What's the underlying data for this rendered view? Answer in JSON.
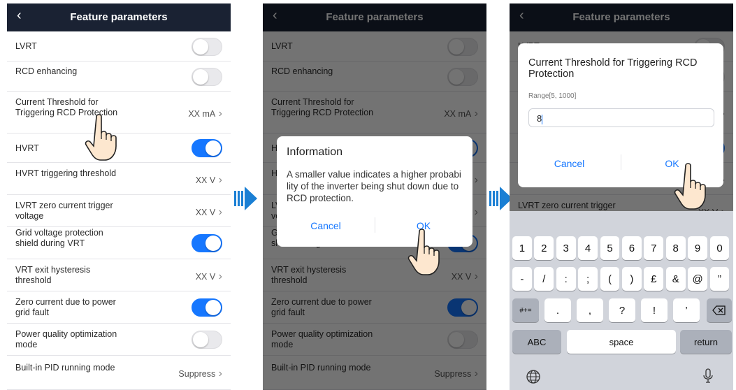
{
  "header_title": "Feature parameters",
  "back_icon": "‹",
  "rows": [
    {
      "label": "LVRT",
      "toggle": "off"
    },
    {
      "label": "RCD enhancing",
      "toggle": "off"
    },
    {
      "label": "Current Threshold for Triggering RCD Protection",
      "value": "XX mA"
    },
    {
      "label": "HVRT",
      "toggle": "on"
    },
    {
      "label": "HVRT triggering threshold",
      "value": "XX V"
    },
    {
      "label": "LVRT zero current trigger voltage",
      "value": "XX V"
    },
    {
      "label": "Grid voltage protection shield during VRT",
      "toggle": "on"
    },
    {
      "label": "VRT exit hysteresis threshold",
      "value": "XX V"
    },
    {
      "label": "Zero current due to power grid fault",
      "toggle": "on"
    },
    {
      "label": "Power quality optimization mode",
      "toggle": "off"
    },
    {
      "label": "Built-in PID running mode",
      "value": "Suppress"
    }
  ],
  "info_dialog": {
    "title": "Information",
    "message": "A smaller value indicates a higher probability of the inverter being shut down due to RCD protection.",
    "cancel": "Cancel",
    "ok": "OK"
  },
  "input_dialog": {
    "title": "Current Threshold for Triggering RCD Protection",
    "range": "Range[5, 1000]",
    "value": "8",
    "cancel": "Cancel",
    "ok": "OK"
  },
  "keyboard": {
    "row1": [
      "1",
      "2",
      "3",
      "4",
      "5",
      "6",
      "7",
      "8",
      "9",
      "0"
    ],
    "row2": [
      "-",
      "/",
      ":",
      ";",
      "(",
      ")",
      "£",
      "&",
      "@",
      "”"
    ],
    "row3": [
      ".",
      ",",
      "?",
      "!",
      "’"
    ],
    "shift_label": "#+=",
    "abc_label": "ABC",
    "space_label": "space",
    "return_label": "return"
  },
  "colors": {
    "header": "#1a2233",
    "accent": "#1677ff",
    "arrow": "#1a7fd4"
  }
}
